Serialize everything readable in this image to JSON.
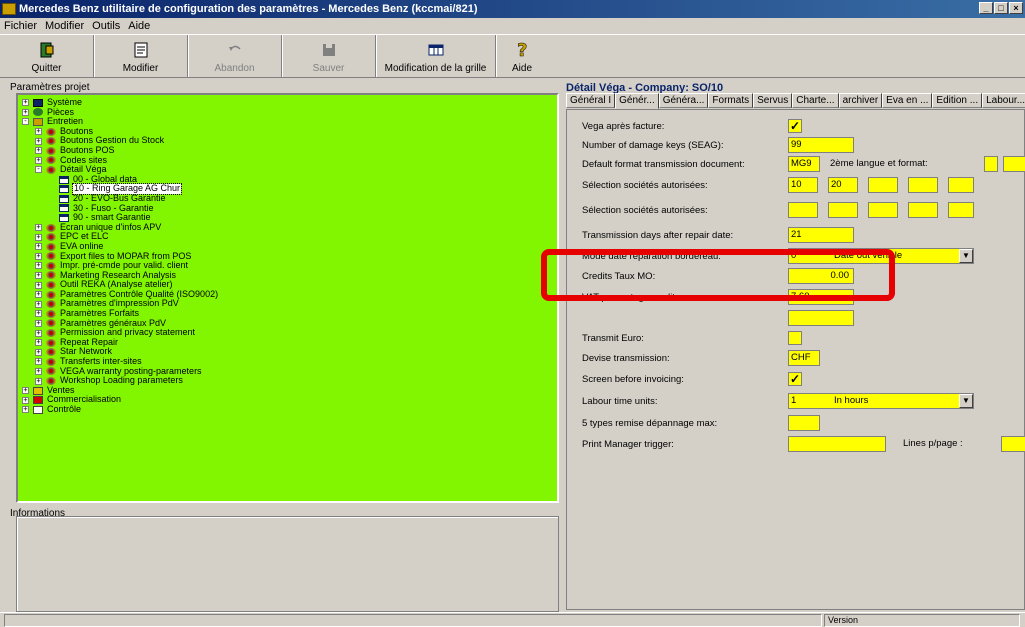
{
  "window": {
    "title": "Mercedes Benz utilitaire de configuration des paramètres - Mercedes Benz (kccmai/821)",
    "minimize": "_",
    "maximize": "□",
    "close": "×"
  },
  "menu": [
    "Fichier",
    "Modifier",
    "Outils",
    "Aide"
  ],
  "toolbar": {
    "quit": "Quitter",
    "modify": "Modifier",
    "cancel": "Abandon",
    "save": "Sauver",
    "grid": "Modification de la grille",
    "help": "Aide"
  },
  "tree": {
    "group_label": "Paramètres projet",
    "items": [
      {
        "label": "Système",
        "depth": 0,
        "exp": "+",
        "icon": "sys"
      },
      {
        "label": "Pièces",
        "depth": 0,
        "exp": "+",
        "icon": "piece"
      },
      {
        "label": "Entretien",
        "depth": 0,
        "exp": "-",
        "icon": "folder"
      },
      {
        "label": "Boutons",
        "depth": 1,
        "exp": "+",
        "icon": "gear"
      },
      {
        "label": "Boutons Gestion du Stock",
        "depth": 1,
        "exp": "+",
        "icon": "gear"
      },
      {
        "label": "Boutons POS",
        "depth": 1,
        "exp": "+",
        "icon": "gear"
      },
      {
        "label": "Codes sites",
        "depth": 1,
        "exp": "+",
        "icon": "gear"
      },
      {
        "label": "Détail Véga",
        "depth": 1,
        "exp": "-",
        "icon": "gear"
      },
      {
        "label": "00 - Global data",
        "depth": 2,
        "exp": "",
        "icon": "grid"
      },
      {
        "label": "10 - Ring Garage AG Chur",
        "depth": 2,
        "exp": "",
        "icon": "grid",
        "selected": true
      },
      {
        "label": "20 - EVO-Bus Garantie",
        "depth": 2,
        "exp": "",
        "icon": "grid"
      },
      {
        "label": "30 - Fuso - Garantie",
        "depth": 2,
        "exp": "",
        "icon": "grid"
      },
      {
        "label": "90 - smart Garantie",
        "depth": 2,
        "exp": "",
        "icon": "grid"
      },
      {
        "label": "Ecran unique d'infos APV",
        "depth": 1,
        "exp": "+",
        "icon": "gear"
      },
      {
        "label": "EPC et ELC",
        "depth": 1,
        "exp": "+",
        "icon": "gear"
      },
      {
        "label": "EVA online",
        "depth": 1,
        "exp": "+",
        "icon": "gear"
      },
      {
        "label": "Export files to MOPAR from POS",
        "depth": 1,
        "exp": "+",
        "icon": "gear"
      },
      {
        "label": "Impr. pré-cmde pour valid. client",
        "depth": 1,
        "exp": "+",
        "icon": "gear"
      },
      {
        "label": "Marketing Research Analysis",
        "depth": 1,
        "exp": "+",
        "icon": "gear"
      },
      {
        "label": "Outil REKA (Analyse atelier)",
        "depth": 1,
        "exp": "+",
        "icon": "gear"
      },
      {
        "label": "Paramètres Contrôle Qualité (ISO9002)",
        "depth": 1,
        "exp": "+",
        "icon": "gear"
      },
      {
        "label": "Paramètres d'impression PdV",
        "depth": 1,
        "exp": "+",
        "icon": "gear"
      },
      {
        "label": "Paramètres Forfaits",
        "depth": 1,
        "exp": "+",
        "icon": "gear"
      },
      {
        "label": "Paramètres généraux PdV",
        "depth": 1,
        "exp": "+",
        "icon": "gear"
      },
      {
        "label": "Permission and privacy statement",
        "depth": 1,
        "exp": "+",
        "icon": "gear"
      },
      {
        "label": "Repeat Repair",
        "depth": 1,
        "exp": "+",
        "icon": "gear"
      },
      {
        "label": "Star Network",
        "depth": 1,
        "exp": "+",
        "icon": "gear"
      },
      {
        "label": "Transferts inter-sites",
        "depth": 1,
        "exp": "+",
        "icon": "gear"
      },
      {
        "label": "VEGA warranty posting-parameters",
        "depth": 1,
        "exp": "+",
        "icon": "gear"
      },
      {
        "label": "Workshop Loading parameters",
        "depth": 1,
        "exp": "+",
        "icon": "gear"
      },
      {
        "label": "Ventes",
        "depth": 0,
        "exp": "+",
        "icon": "ventes"
      },
      {
        "label": "Commercialisation",
        "depth": 0,
        "exp": "+",
        "icon": "comm"
      },
      {
        "label": "Contrôle",
        "depth": 0,
        "exp": "+",
        "icon": "ctrl"
      }
    ]
  },
  "info": {
    "label": "Informations"
  },
  "detail": {
    "title": "Détail Véga - Company: SO/10",
    "tabs": [
      "Général I",
      "Génér...",
      "Généra...",
      "Formats",
      "Servus",
      "Charte...",
      "archiver",
      "Eva en ...",
      "Edition ...",
      "Labour..."
    ],
    "active_tab": 1,
    "labels": {
      "vega_after_invoice": "Vega après facture:",
      "damage_keys": "Number of damage keys (SEAG):",
      "default_format": "Default format transmission document:",
      "second_lang": "2ème langue et format:",
      "companies_1": "Sélection sociétés autorisées:",
      "companies_2": "Sélection sociétés autorisées:",
      "transmission_days": "Transmission days after repair date:",
      "date_mode": "Mode date réparation bordereau:",
      "credits_rate": "Credits Taux MO:",
      "vat_credits": "VAT percentage credits:",
      "transmit_euro": "Transmit Euro:",
      "currency": "Devise transmission:",
      "screen_before": "Screen before invoicing:",
      "labour_units": "Labour time units:",
      "remise": "5 types remise dépannage max:",
      "print_manager": "Print Manager trigger:",
      "lines_page": "Lines p/page :"
    },
    "values": {
      "vega_after_invoice": "✓",
      "damage_keys": "99",
      "default_format": "MG9",
      "company_a": "10",
      "company_b": "20",
      "transmission_days": "21",
      "date_mode_code": "0",
      "date_mode_text": "Date out vehicle",
      "credits_rate": "0.00",
      "vat_credits": "7.60",
      "currency": "CHF",
      "screen_before": "✓",
      "labour_code": "1",
      "labour_text": "In hours"
    }
  },
  "status": {
    "version": "Version"
  },
  "colors": {
    "tree_bg": "#82f500",
    "field_bg": "#ffff00",
    "highlight": "#e60000"
  }
}
